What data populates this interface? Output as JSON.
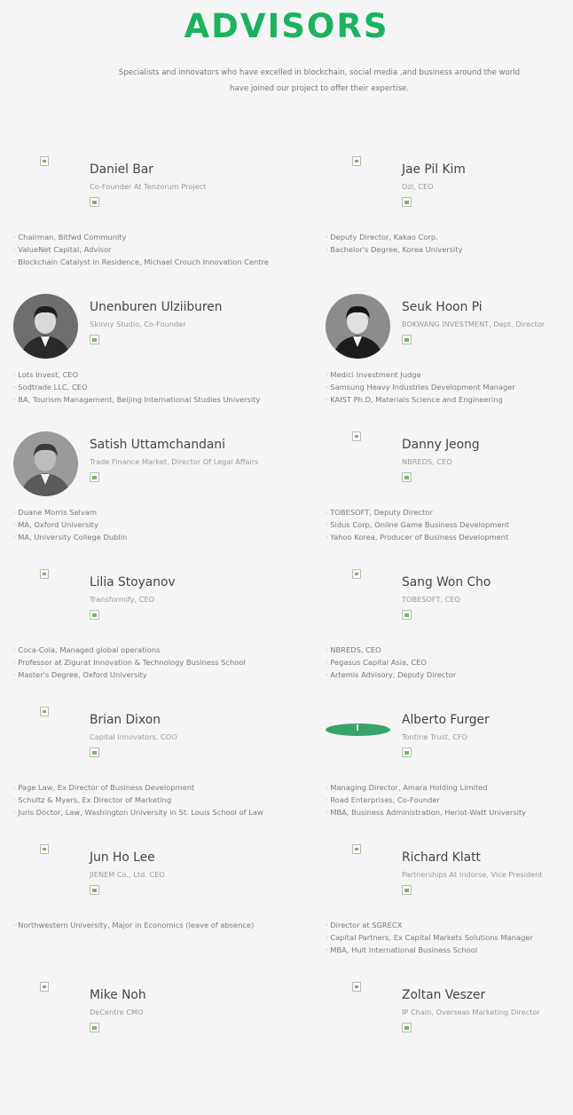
{
  "page": {
    "title": "ADVISORS",
    "intro_line1": "Specialists and innovators who have excelled in blockchain, social media ,and business around the world",
    "intro_line2": "have joined our project to offer their expertise.",
    "accent_color": "#1bb35e"
  },
  "advisors": [
    {
      "name": "Daniel Bar",
      "role": "Co-Founder At Tenzorum Project",
      "photo": "broken-image-icon",
      "details": [
        "Chairman, Bitfwd Community",
        "ValueNet Capital, Advisor",
        "Blockchain Catalyst in Residence, Michael Crouch Innovation Centre"
      ]
    },
    {
      "name": "Jae Pil Kim",
      "role": "Ozl, CEO",
      "photo": "broken-image-icon",
      "details": [
        "Deputy Director, Kakao Corp.",
        "Bachelor's Degree, Korea University"
      ]
    },
    {
      "name": "Unenburen Ulziiburen",
      "role": "Skinny Studio, Co-Founder",
      "photo": "portrait-photo",
      "details": [
        "Lots Invest, CEO",
        "Sodtrade LLC, CEO",
        "BA, Tourism Management, Beijing International Studies University"
      ]
    },
    {
      "name": "Seuk Hoon Pi",
      "role": "BOKWANG INVESTMENT, Dept. Director",
      "photo": "portrait-photo",
      "details": [
        "Medici Investment Judge",
        "Samsung Heavy Industries Development Manager",
        "KAIST Ph.D, Materials Science and Engineering"
      ]
    },
    {
      "name": "Satish Uttamchandani",
      "role": "Trade Finance Market, Director Of Legal Affairs",
      "photo": "portrait-photo",
      "details": [
        "Duane Morris Selvam",
        "MA, Oxford University",
        "MA, University College Dublin"
      ]
    },
    {
      "name": "Danny Jeong",
      "role": "NBREDS, CEO",
      "photo": "broken-image-icon",
      "details": [
        "TOBESOFT, Deputy Director",
        "Sidus Corp, Online Game Business Development",
        "Yahoo Korea, Producer of Business Development"
      ]
    },
    {
      "name": "Lilia Stoyanov",
      "role": "Transformify, CEO",
      "photo": "broken-image-icon",
      "details": [
        "Coca-Cola, Managed global operations",
        "Professor at Zigurat Innovation & Technology Business School",
        "Master's Degree, Oxford University"
      ]
    },
    {
      "name": "Sang Won Cho",
      "role": "TOBESOFT, CEO",
      "photo": "broken-image-icon",
      "details": [
        "NBREDS, CEO",
        "Pegasus Capital Asia, CEO",
        "Artemis Advisory, Deputy Director"
      ]
    },
    {
      "name": "Brian Dixon",
      "role": "Capital Innovators, COO",
      "photo": "broken-image-icon",
      "details": [
        "Page Law, Ex Director of Business Development",
        "Schultz & Myers, Ex Director of Marketing",
        "Juris Doctor, Law, Washington University in St. Louis School of Law"
      ]
    },
    {
      "name": "Alberto Furger",
      "role": "Tontine Trust, CFO",
      "photo": "green-oval",
      "details": [
        "Managing Director, Amara Holding Limited",
        "Road Enterprises, Co-Founder",
        "MBA, Business Administration, Heriot-Watt University"
      ]
    },
    {
      "name": "Jun Ho Lee",
      "role": "JIENEM Co., Ltd. CEO",
      "photo": "broken-image-icon",
      "details": [
        "Northwestern University, Major in Economics (leave of absence)"
      ]
    },
    {
      "name": "Richard Klatt",
      "role": "Partnerships At Indorse, Vice President",
      "photo": "broken-image-icon",
      "details": [
        "Director at SGRECX",
        "Capital Partners, Ex Capital Markets Solutions Manager",
        "MBA, Hult International Business School"
      ]
    },
    {
      "name": "Mike Noh",
      "role": "DeCentre CMO",
      "photo": "broken-image-icon",
      "details": []
    },
    {
      "name": "Zoltan Veszer",
      "role": "IP Chain, Overseas Marketing Director",
      "photo": "broken-image-icon",
      "details": []
    }
  ]
}
